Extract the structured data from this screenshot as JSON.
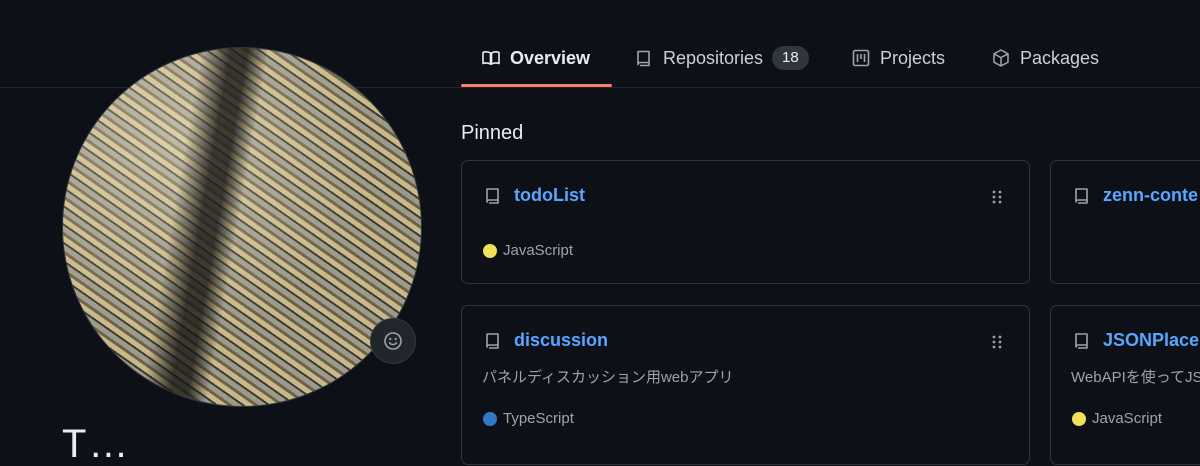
{
  "tabs": [
    {
      "label": "Overview",
      "icon": "book-icon",
      "selected": true
    },
    {
      "label": "Repositories",
      "icon": "repo-icon",
      "count": "18"
    },
    {
      "label": "Projects",
      "icon": "project-icon"
    },
    {
      "label": "Packages",
      "icon": "package-icon"
    }
  ],
  "profile": {
    "avatar_alt": "avatar",
    "status_icon": "smiley-icon",
    "name_partial": "T…"
  },
  "pinned": {
    "title": "Pinned",
    "cards": [
      {
        "name": "todoList",
        "description": "",
        "language": "JavaScript",
        "language_color": "#f1e05a"
      },
      {
        "name": "zenn-conte",
        "description": "",
        "language": "",
        "language_color": ""
      },
      {
        "name": "discussion",
        "description": "パネルディスカッション用webアプリ",
        "language": "TypeScript",
        "language_color": "#3178c6"
      },
      {
        "name": "JSONPlace",
        "description": "WebAPIを使ってJS",
        "language": "JavaScript",
        "language_color": "#f1e05a"
      }
    ]
  },
  "colors": {
    "background": "#0d1117",
    "border": "#30363d",
    "link": "#58a6ff",
    "tab_underline": "#f78166",
    "muted_text": "#9ba3ad"
  }
}
